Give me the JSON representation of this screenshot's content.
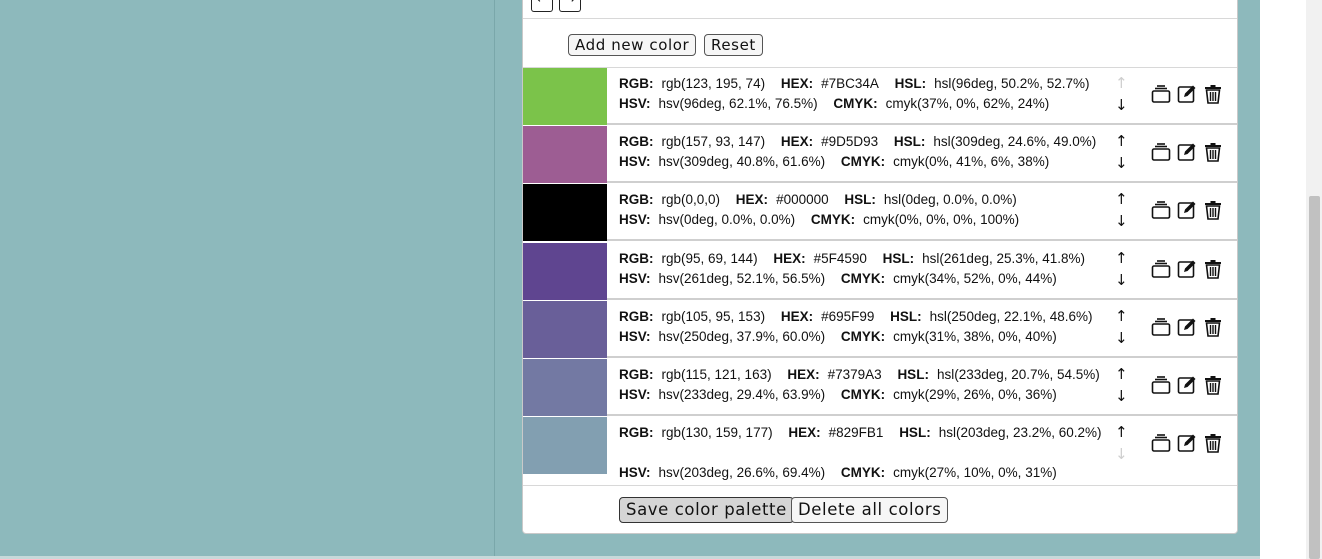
{
  "nav": {
    "prev_label": "←",
    "next_label": "→"
  },
  "toolbar": {
    "add_label": "Add new color",
    "reset_label": "Reset"
  },
  "labels": {
    "rgb": "RGB:",
    "hex": "HEX:",
    "hsl": "HSL:",
    "hsv": "HSV:",
    "cmyk": "CMYK:"
  },
  "colors": [
    {
      "swatch": "#7BC34A",
      "rgb": "rgb(123, 195, 74)",
      "hex": "#7BC34A",
      "hsl": "hsl(96deg, 50.2%, 52.7%)",
      "hsv": "hsv(96deg, 62.1%, 76.5%)",
      "cmyk": "cmyk(37%, 0%, 62%, 24%)",
      "up": "↑",
      "down": "↓"
    },
    {
      "swatch": "#9D5D93",
      "rgb": "rgb(157, 93, 147)",
      "hex": "#9D5D93",
      "hsl": "hsl(309deg, 24.6%, 49.0%)",
      "hsv": "hsv(309deg, 40.8%, 61.6%)",
      "cmyk": "cmyk(0%, 41%, 6%, 38%)",
      "up": "↑",
      "down": "↓"
    },
    {
      "swatch": "#000000",
      "rgb": "rgb(0,0,0)",
      "hex": "#000000",
      "hsl": "hsl(0deg, 0.0%, 0.0%)",
      "hsv": "hsv(0deg, 0.0%, 0.0%)",
      "cmyk": "cmyk(0%, 0%, 0%, 100%)",
      "up": "↑",
      "down": "↓"
    },
    {
      "swatch": "#5F4590",
      "rgb": "rgb(95, 69, 144)",
      "hex": "#5F4590",
      "hsl": "hsl(261deg, 25.3%, 41.8%)",
      "hsv": "hsv(261deg, 52.1%, 56.5%)",
      "cmyk": "cmyk(34%, 52%, 0%, 44%)",
      "up": "↑",
      "down": "↓"
    },
    {
      "swatch": "#695F99",
      "rgb": "rgb(105, 95, 153)",
      "hex": "#695F99",
      "hsl": "hsl(250deg, 22.1%, 48.6%)",
      "hsv": "hsv(250deg, 37.9%, 60.0%)",
      "cmyk": "cmyk(31%, 38%, 0%, 40%)",
      "up": "↑",
      "down": "↓"
    },
    {
      "swatch": "#7379A3",
      "rgb": "rgb(115, 121, 163)",
      "hex": "#7379A3",
      "hsl": "hsl(233deg, 20.7%, 54.5%)",
      "hsv": "hsv(233deg, 29.4%, 63.9%)",
      "cmyk": "cmyk(29%, 26%, 0%, 36%)",
      "up": "↑",
      "down": "↓"
    },
    {
      "swatch": "#829FB1",
      "rgb": "rgb(130, 159, 177)",
      "hex": "#829FB1",
      "hsl": "hsl(203deg, 23.2%, 60.2%)",
      "hsv": "hsv(203deg, 26.6%, 69.4%)",
      "cmyk": "cmyk(27%, 10%, 0%, 31%)",
      "up": "↑",
      "down": "↓"
    }
  ],
  "footer": {
    "save_label": "Save color palette",
    "delete_all_label": "Delete all colors"
  },
  "icons": {
    "copy": "copy-icon",
    "edit": "edit-icon",
    "delete": "trash-icon"
  }
}
